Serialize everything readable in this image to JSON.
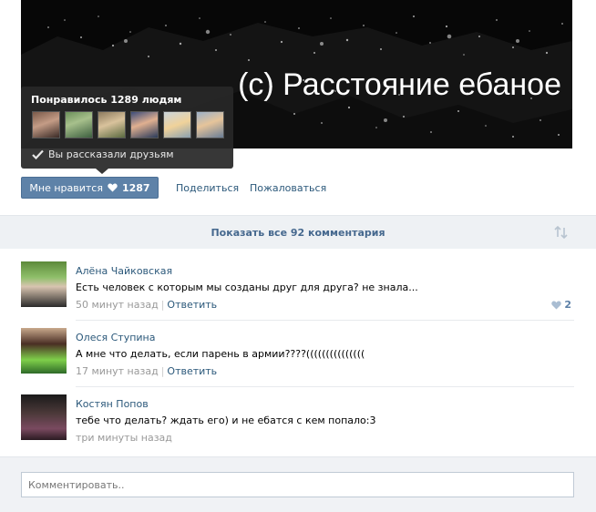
{
  "post": {
    "banner_title": "(c) Расстояние ебаное"
  },
  "like_popup": {
    "title": "Понравилось 1289 людям",
    "shared_label": "Вы рассказали друзьям",
    "friend_avatars": [
      "friend-1",
      "friend-2",
      "friend-3",
      "friend-4",
      "friend-5",
      "friend-6"
    ]
  },
  "actions": {
    "like_label": "Мне нравится",
    "like_count": "1287",
    "share_label": "Поделиться",
    "report_label": "Пожаловаться"
  },
  "comments_header": {
    "show_all_label": "Показать все 92 комментария"
  },
  "comments": [
    {
      "author": "Алёна Чайковская",
      "text": "Есть человек с которым мы созданы друг для друга? не знала...",
      "time": "50 минут назад",
      "reply_label": "Ответить",
      "likes": "2"
    },
    {
      "author": "Олеся Ступина",
      "text": "А мне что делать, если парень в армии????(((((((((((((((",
      "time": "17 минут назад",
      "reply_label": "Ответить"
    },
    {
      "author": "Костян Попов",
      "text": "тебе что делать? ждать его) и не ебатся с кем попало:3",
      "time": "три минуты назад"
    }
  ],
  "comment_box": {
    "placeholder": "Комментировать.."
  },
  "colors": {
    "link": "#2b587a",
    "like_button": "#5e82a8",
    "popup": "#282828"
  }
}
